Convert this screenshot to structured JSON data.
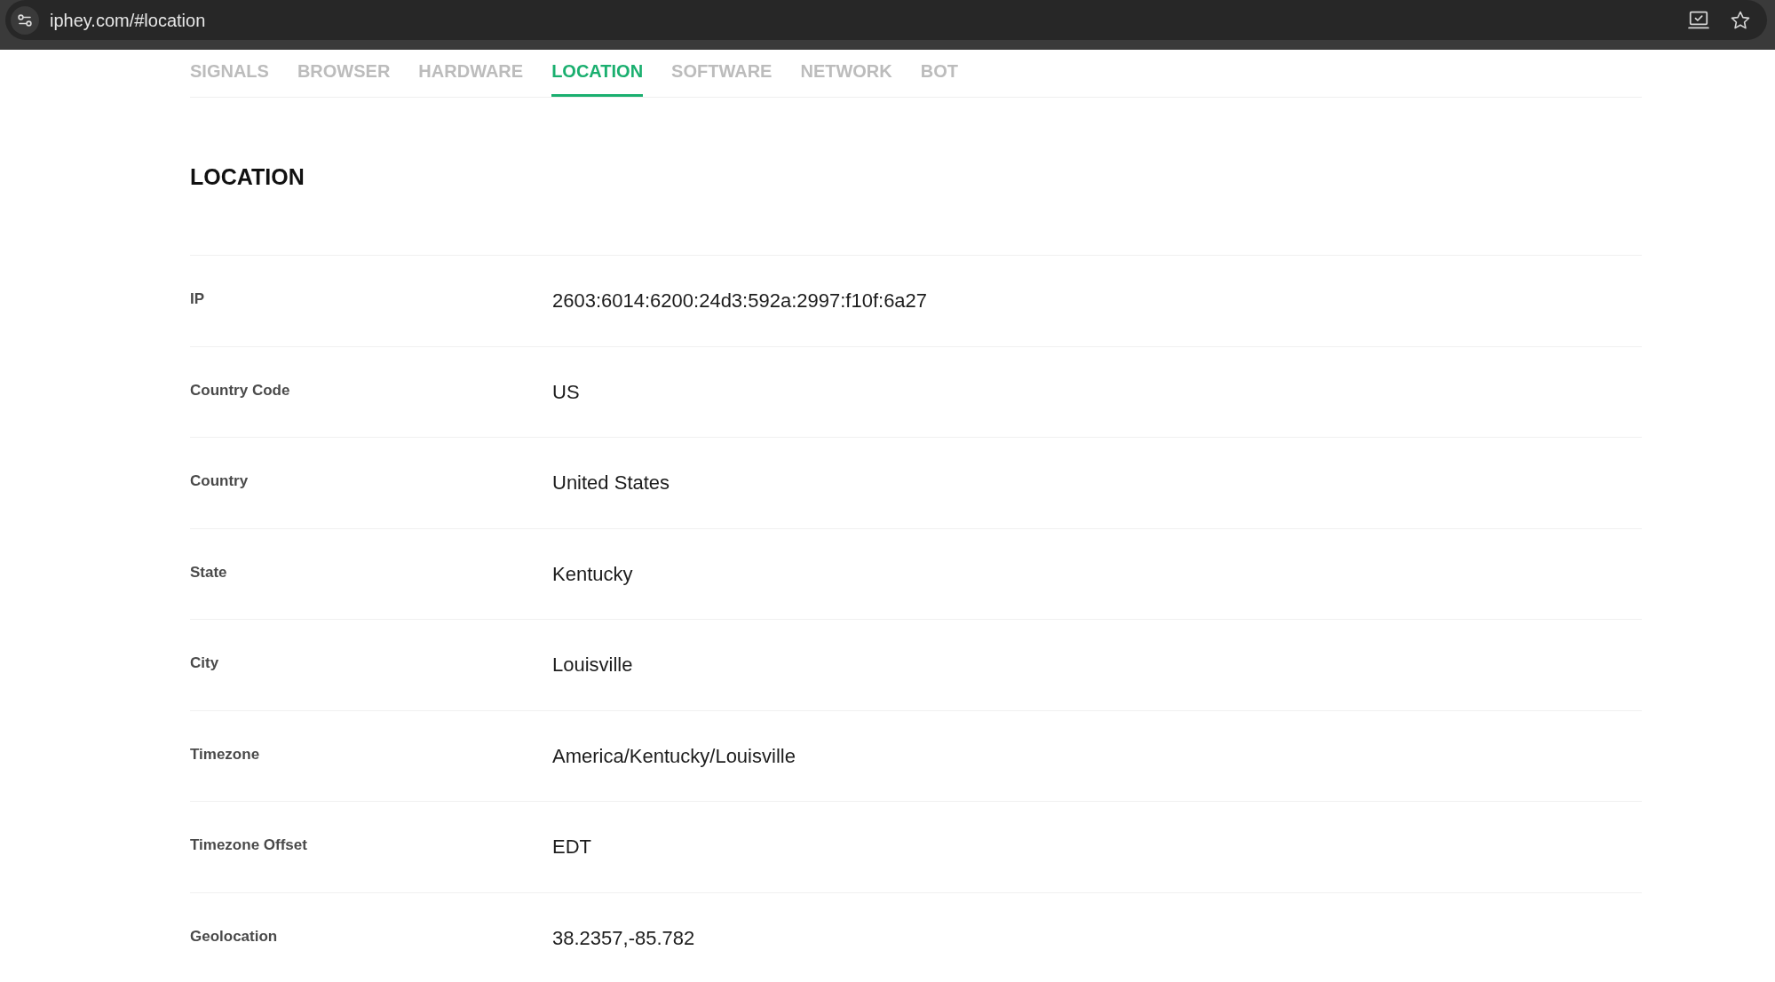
{
  "browser": {
    "url": "iphey.com/#location"
  },
  "tabs": [
    {
      "label": "SIGNALS",
      "selected": false
    },
    {
      "label": "BROWSER",
      "selected": false
    },
    {
      "label": "HARDWARE",
      "selected": false
    },
    {
      "label": "LOCATION",
      "selected": true
    },
    {
      "label": "SOFTWARE",
      "selected": false
    },
    {
      "label": "NETWORK",
      "selected": false
    },
    {
      "label": "BOT",
      "selected": false
    }
  ],
  "section": {
    "title": "LOCATION",
    "rows": [
      {
        "label": "IP",
        "value": "2603:6014:6200:24d3:592a:2997:f10f:6a27"
      },
      {
        "label": "Country Code",
        "value": "US"
      },
      {
        "label": "Country",
        "value": "United States"
      },
      {
        "label": "State",
        "value": "Kentucky"
      },
      {
        "label": "City",
        "value": "Louisville"
      },
      {
        "label": "Timezone",
        "value": "America/Kentucky/Louisville"
      },
      {
        "label": "Timezone Offset",
        "value": "EDT"
      },
      {
        "label": "Geolocation",
        "value": "38.2357,-85.782"
      }
    ]
  }
}
